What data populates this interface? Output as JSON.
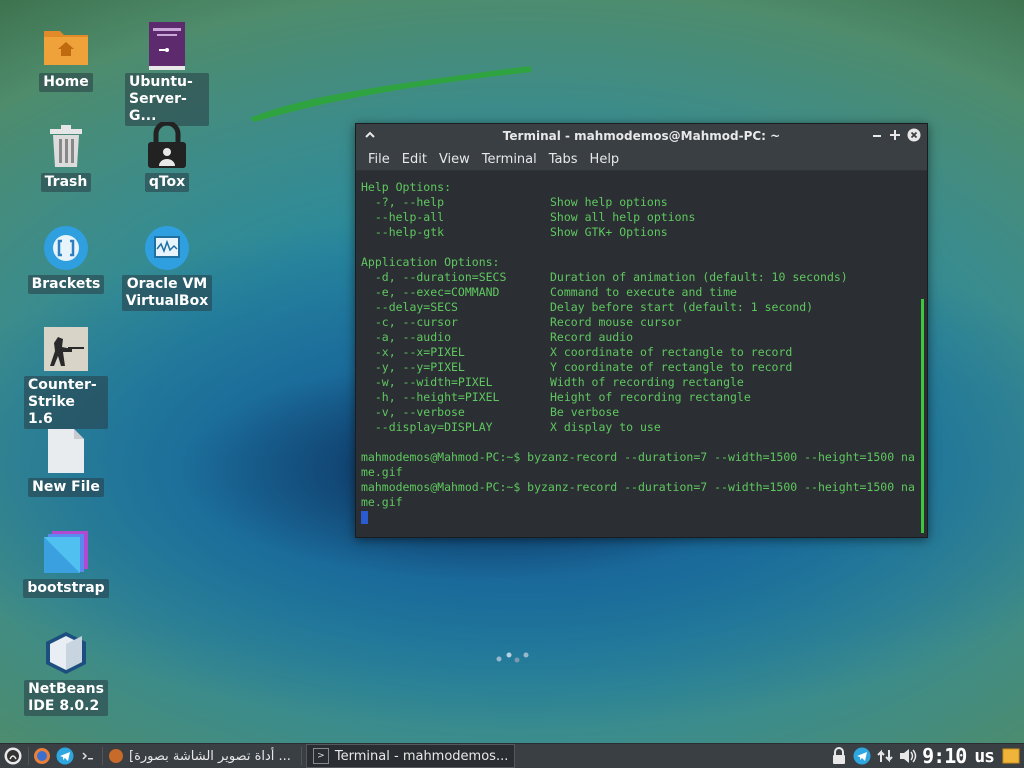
{
  "desktop": {
    "icons": [
      {
        "label": "Home"
      },
      {
        "label": "Ubuntu-\nServer-G..."
      },
      {
        "label": "Trash"
      },
      {
        "label": "qTox"
      },
      {
        "label": "Brackets"
      },
      {
        "label": "Oracle VM\nVirtualBox"
      },
      {
        "label": "Counter-\nStrike 1.6"
      },
      {
        "label": "New File"
      },
      {
        "label": "bootstrap"
      },
      {
        "label": "NetBeans\nIDE 8.0.2"
      }
    ]
  },
  "terminal": {
    "title": "Terminal - mahmodemos@Mahmod-PC: ~",
    "menu": [
      "File",
      "Edit",
      "View",
      "Terminal",
      "Tabs",
      "Help"
    ],
    "lines": [
      {
        "a": "Help Options:",
        "b": ""
      },
      {
        "a": "  -?, --help",
        "b": "Show help options"
      },
      {
        "a": "  --help-all",
        "b": "Show all help options"
      },
      {
        "a": "  --help-gtk",
        "b": "Show GTK+ Options"
      },
      {
        "a": "",
        "b": ""
      },
      {
        "a": "Application Options:",
        "b": ""
      },
      {
        "a": "  -d, --duration=SECS",
        "b": "Duration of animation (default: 10 seconds)"
      },
      {
        "a": "  -e, --exec=COMMAND",
        "b": "Command to execute and time"
      },
      {
        "a": "  --delay=SECS",
        "b": "Delay before start (default: 1 second)"
      },
      {
        "a": "  -c, --cursor",
        "b": "Record mouse cursor"
      },
      {
        "a": "  -a, --audio",
        "b": "Record audio"
      },
      {
        "a": "  -x, --x=PIXEL",
        "b": "X coordinate of rectangle to record"
      },
      {
        "a": "  -y, --y=PIXEL",
        "b": "Y coordinate of rectangle to record"
      },
      {
        "a": "  -w, --width=PIXEL",
        "b": "Width of recording rectangle"
      },
      {
        "a": "  -h, --height=PIXEL",
        "b": "Height of recording rectangle"
      },
      {
        "a": "  -v, --verbose",
        "b": "Be verbose"
      },
      {
        "a": "  --display=DISPLAY",
        "b": "X display to use"
      },
      {
        "a": "",
        "b": ""
      },
      {
        "a": "mahmodemos@Mahmod-PC:~$ byzanz-record --duration=7 --width=1500 --height=1500 na",
        "b": ""
      },
      {
        "a": "me.gif",
        "b": ""
      },
      {
        "a": "mahmodemos@Mahmod-PC:~$ byzanz-record --duration=7 --width=1500 --height=1500 na",
        "b": ""
      },
      {
        "a": "me.gif",
        "b": ""
      }
    ]
  },
  "taskbar": {
    "task1": "[أداة تصوير الشاشة بصورة ...",
    "task2": "Terminal - mahmodemos...",
    "clock": "9:10",
    "layout": "us"
  },
  "colors": {
    "terminal_text": "#5fc75f",
    "terminal_bg": "#2b2f33",
    "panel_bg": "#3a3f44"
  }
}
